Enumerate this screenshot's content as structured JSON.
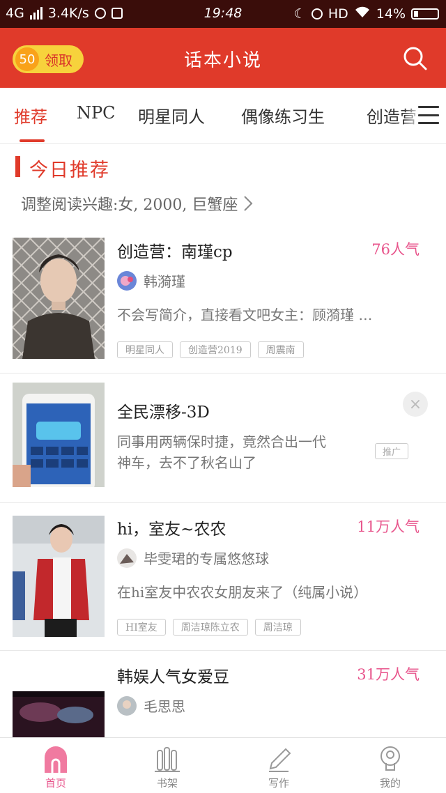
{
  "status_bar": {
    "network": "4G",
    "speed": "3.4K/s",
    "time": "19:48",
    "hd": "HD",
    "battery": "14%"
  },
  "header": {
    "coin_count": "50",
    "coin_label": "领取",
    "title": "话本小说"
  },
  "tabs": [
    {
      "label": "推荐",
      "active": true
    },
    {
      "label": "NPC"
    },
    {
      "label": "明星同人"
    },
    {
      "label": "偶像练习生"
    },
    {
      "label": "创造营"
    }
  ],
  "section": {
    "title": "今日推荐",
    "interest": "调整阅读兴趣:女, 2000, 巨蟹座"
  },
  "cards": [
    {
      "title": "创造营：南瑾cp",
      "popularity": "76人气",
      "author": "韩漪瑾",
      "description": "不会写简介，直接看文吧女主：顾漪瑾 …",
      "tags": [
        "明星同人",
        "创造营2019",
        "周震南"
      ]
    },
    {
      "title": "全民漂移-3D",
      "description_lines": [
        "同事用两辆保时捷，竟然合出一代",
        "神车，去不了秋名山了"
      ],
      "ad_label": "推广",
      "close_glyph": "×"
    },
    {
      "title": "hi，室友~农农",
      "popularity": "11万人气",
      "author": "毕雯珺的专属悠悠球",
      "description": "在hi室友中农农女朋友来了（纯属小说）",
      "tags": [
        "HI室友",
        "周洁琼陈立农",
        "周洁琼"
      ]
    },
    {
      "title": "韩娱人气女爱豆",
      "popularity": "31万人气",
      "author": "毛思思"
    }
  ],
  "bottom_nav": [
    {
      "label": "首页",
      "icon": "home-icon",
      "active": true
    },
    {
      "label": "书架",
      "icon": "bookshelf-icon"
    },
    {
      "label": "写作",
      "icon": "pencil-icon"
    },
    {
      "label": "我的",
      "icon": "profile-icon"
    }
  ],
  "colors": {
    "brand_red": "#e03a2a",
    "popularity_pink": "#e8558c",
    "coin_yellow": "#f7d23c"
  }
}
